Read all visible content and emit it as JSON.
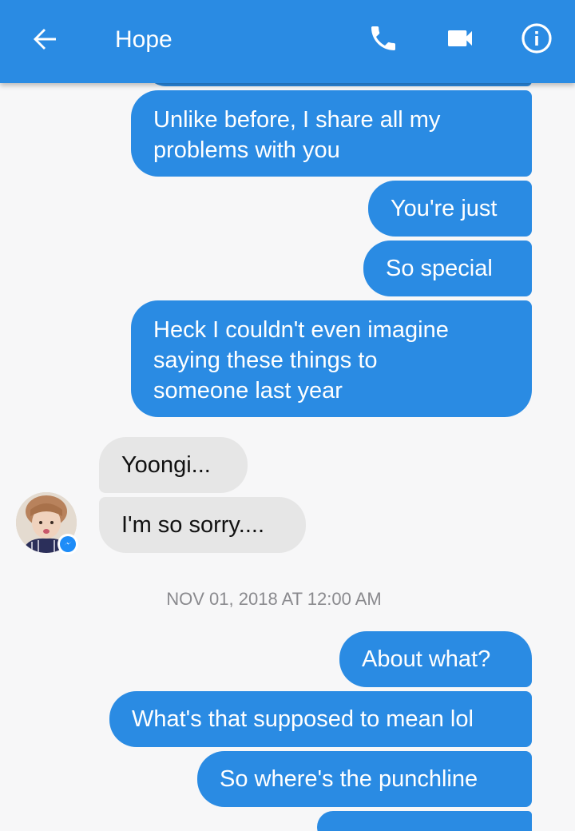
{
  "header": {
    "title": "Hope",
    "back_icon": "arrow-left-icon",
    "call_icon": "phone-icon",
    "video_icon": "video-camera-icon",
    "info_icon": "info-icon"
  },
  "colors": {
    "header": "#2a8be3",
    "outgoing_bubble": "#2a8be3",
    "incoming_bubble": "#e6e6e6",
    "background": "#f7f7f8"
  },
  "messages_before": [
    {
      "direction": "outgoing",
      "lines": [
        "Unlike before, I share all my",
        "problems with you"
      ]
    },
    {
      "direction": "outgoing",
      "lines": [
        "You're just"
      ]
    },
    {
      "direction": "outgoing",
      "lines": [
        "So special"
      ]
    },
    {
      "direction": "outgoing",
      "lines": [
        "Heck I couldn't even imagine",
        "saying these things to",
        "someone last year"
      ]
    },
    {
      "direction": "incoming",
      "lines": [
        "Yoongi..."
      ]
    },
    {
      "direction": "incoming",
      "lines": [
        "I'm so sorry...."
      ]
    }
  ],
  "timestamp": "NOV 01, 2018 AT 12:00 AM",
  "messages_after": [
    {
      "direction": "outgoing",
      "lines": [
        "About what?"
      ]
    },
    {
      "direction": "outgoing",
      "lines": [
        "What's that supposed to mean lol"
      ]
    },
    {
      "direction": "outgoing",
      "lines": [
        "So where's the punchline"
      ]
    }
  ]
}
